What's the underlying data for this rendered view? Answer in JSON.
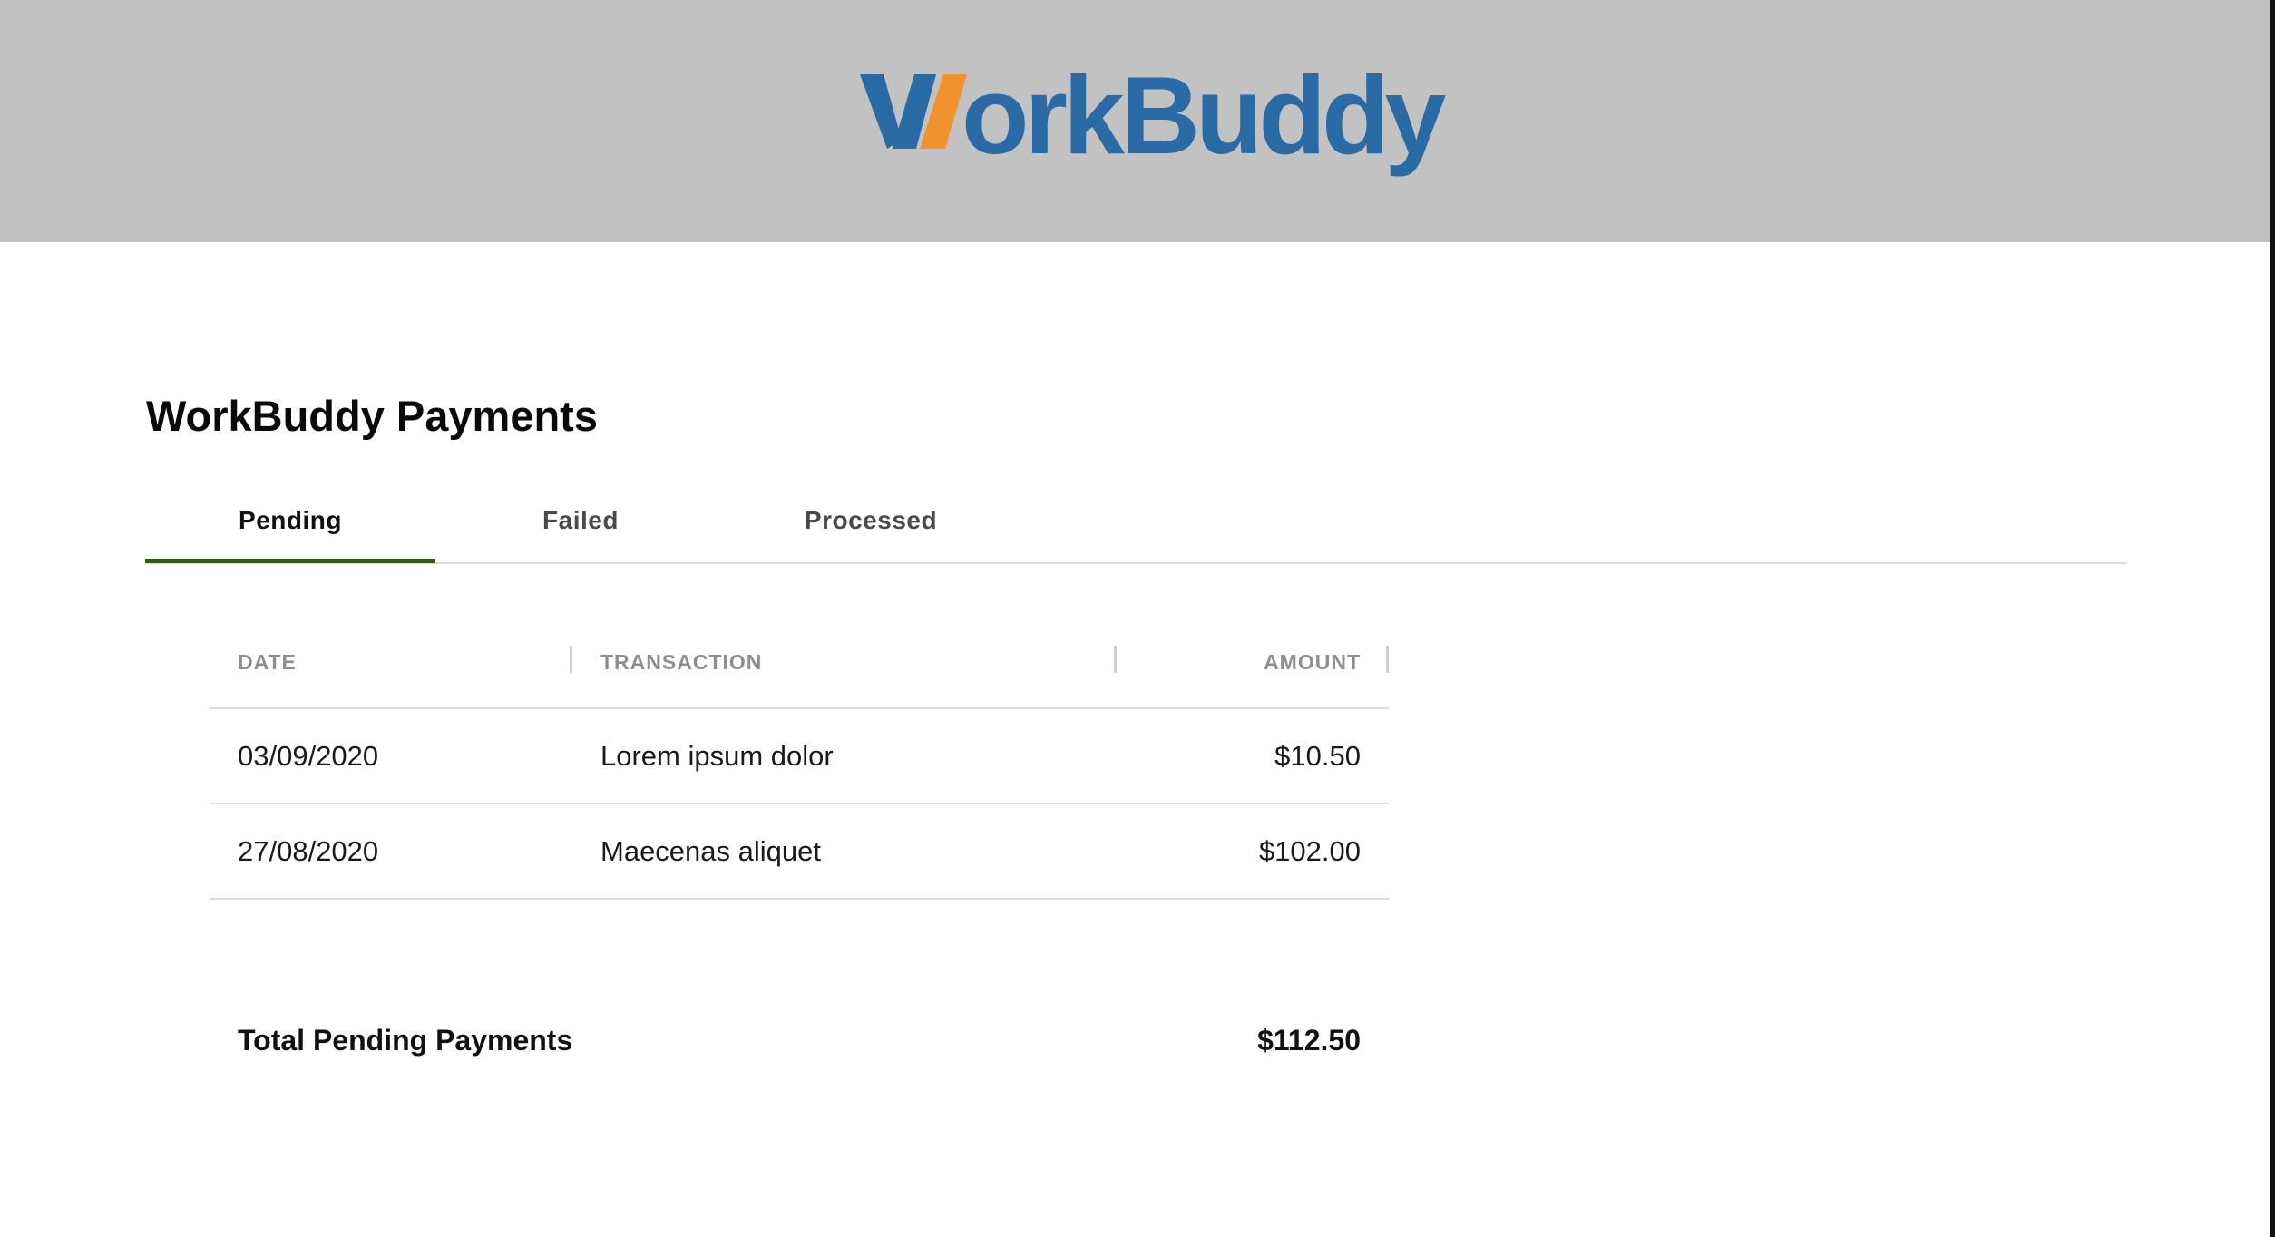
{
  "brand": {
    "logo_text": "WorkBuddy",
    "logo_text_rest": "orkBuddy",
    "primary_color": "#2a6aa5",
    "accent_color": "#f0922e",
    "header_background": "#c2c2c2"
  },
  "page": {
    "title": "WorkBuddy Payments"
  },
  "tabs": [
    {
      "label": "Pending",
      "active": true
    },
    {
      "label": "Failed",
      "active": false
    },
    {
      "label": "Processed",
      "active": false
    }
  ],
  "active_tab_color": "#2f5a17",
  "table": {
    "headers": {
      "date": "DATE",
      "transaction": "TRANSACTION",
      "amount": "AMOUNT"
    },
    "rows": [
      {
        "date": "03/09/2020",
        "transaction": "Lorem ipsum dolor",
        "amount": "$10.50"
      },
      {
        "date": "27/08/2020",
        "transaction": "Maecenas aliquet",
        "amount": "$102.00"
      }
    ]
  },
  "summary": {
    "label": "Total Pending Payments",
    "amount": "$112.50"
  }
}
